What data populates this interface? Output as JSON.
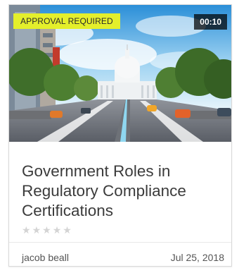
{
  "course_card": {
    "badge": "APPROVAL REQUIRED",
    "duration": "00:10",
    "title": "Government Roles in Regulatory Compliance Certifications",
    "rating_stars": [
      "★",
      "★",
      "★",
      "★",
      "★"
    ],
    "author": "jacob beall",
    "date": "Jul 25, 2018"
  },
  "colors": {
    "badge_bg": "#e4ef2b",
    "title_text": "#3b3b3b",
    "star_inactive": "#d4d4d4"
  }
}
